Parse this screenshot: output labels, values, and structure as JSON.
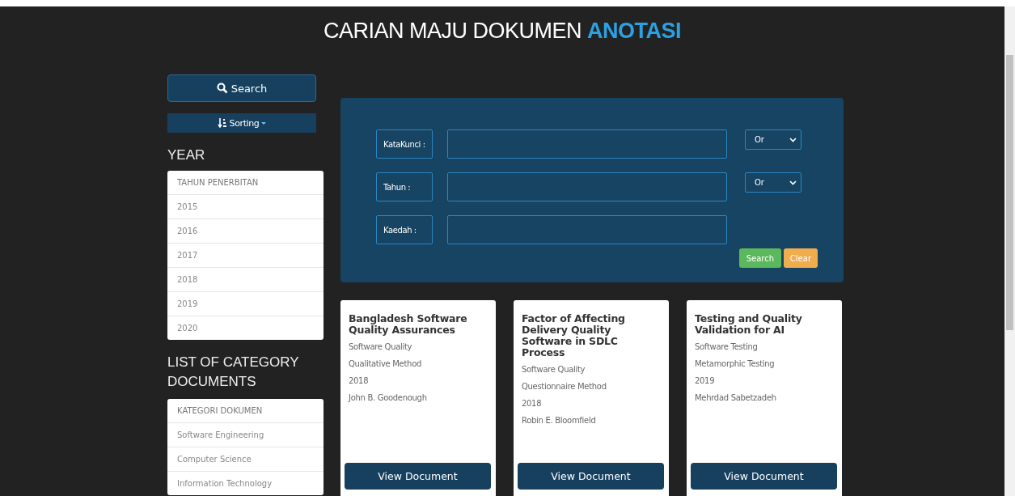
{
  "header": {
    "title": "CARIAN MAJU DOKUMEN",
    "title_highlight": "ANOTASI"
  },
  "sidebar": {
    "search_button": "Search",
    "sorting_button": "Sorting",
    "year_heading": "YEAR",
    "year_list": [
      "TAHUN PENERBITAN",
      "2015",
      "2016",
      "2017",
      "2018",
      "2019",
      "2020"
    ],
    "category_heading": "LIST OF CATEGORY DOCUMENTS",
    "category_list": [
      "KATEGORI DOKUMEN",
      "Software Engineering",
      "Computer Science",
      "Information Technology"
    ]
  },
  "search_form": {
    "rows": [
      {
        "label": "KataKunci :",
        "value": "",
        "operator": "Or"
      },
      {
        "label": "Tahun :",
        "value": "",
        "operator": "Or"
      },
      {
        "label": "Kaedah :",
        "value": ""
      }
    ],
    "buttons": [
      "Search",
      "Clear"
    ]
  },
  "documents": [
    {
      "title": "Bangladesh Software Quality Assurances",
      "lines": [
        "Software Quality",
        "Qualitative Method",
        "2018",
        "John B. Goodenough"
      ],
      "button": "View Document"
    },
    {
      "title": "Factor of Affecting Delivery Quality Software in SDLC Process",
      "lines": [
        "Software Quality",
        "Questionnaire Method",
        "2018",
        "Robin E. Bloomfield"
      ],
      "button": "View Document"
    },
    {
      "title": "Testing and Quality Validation for AI",
      "lines": [
        "Software Testing",
        "Metamorphic Testing",
        "2019",
        "Mehrdad Sabetzadeh"
      ],
      "button": "View Document"
    }
  ]
}
